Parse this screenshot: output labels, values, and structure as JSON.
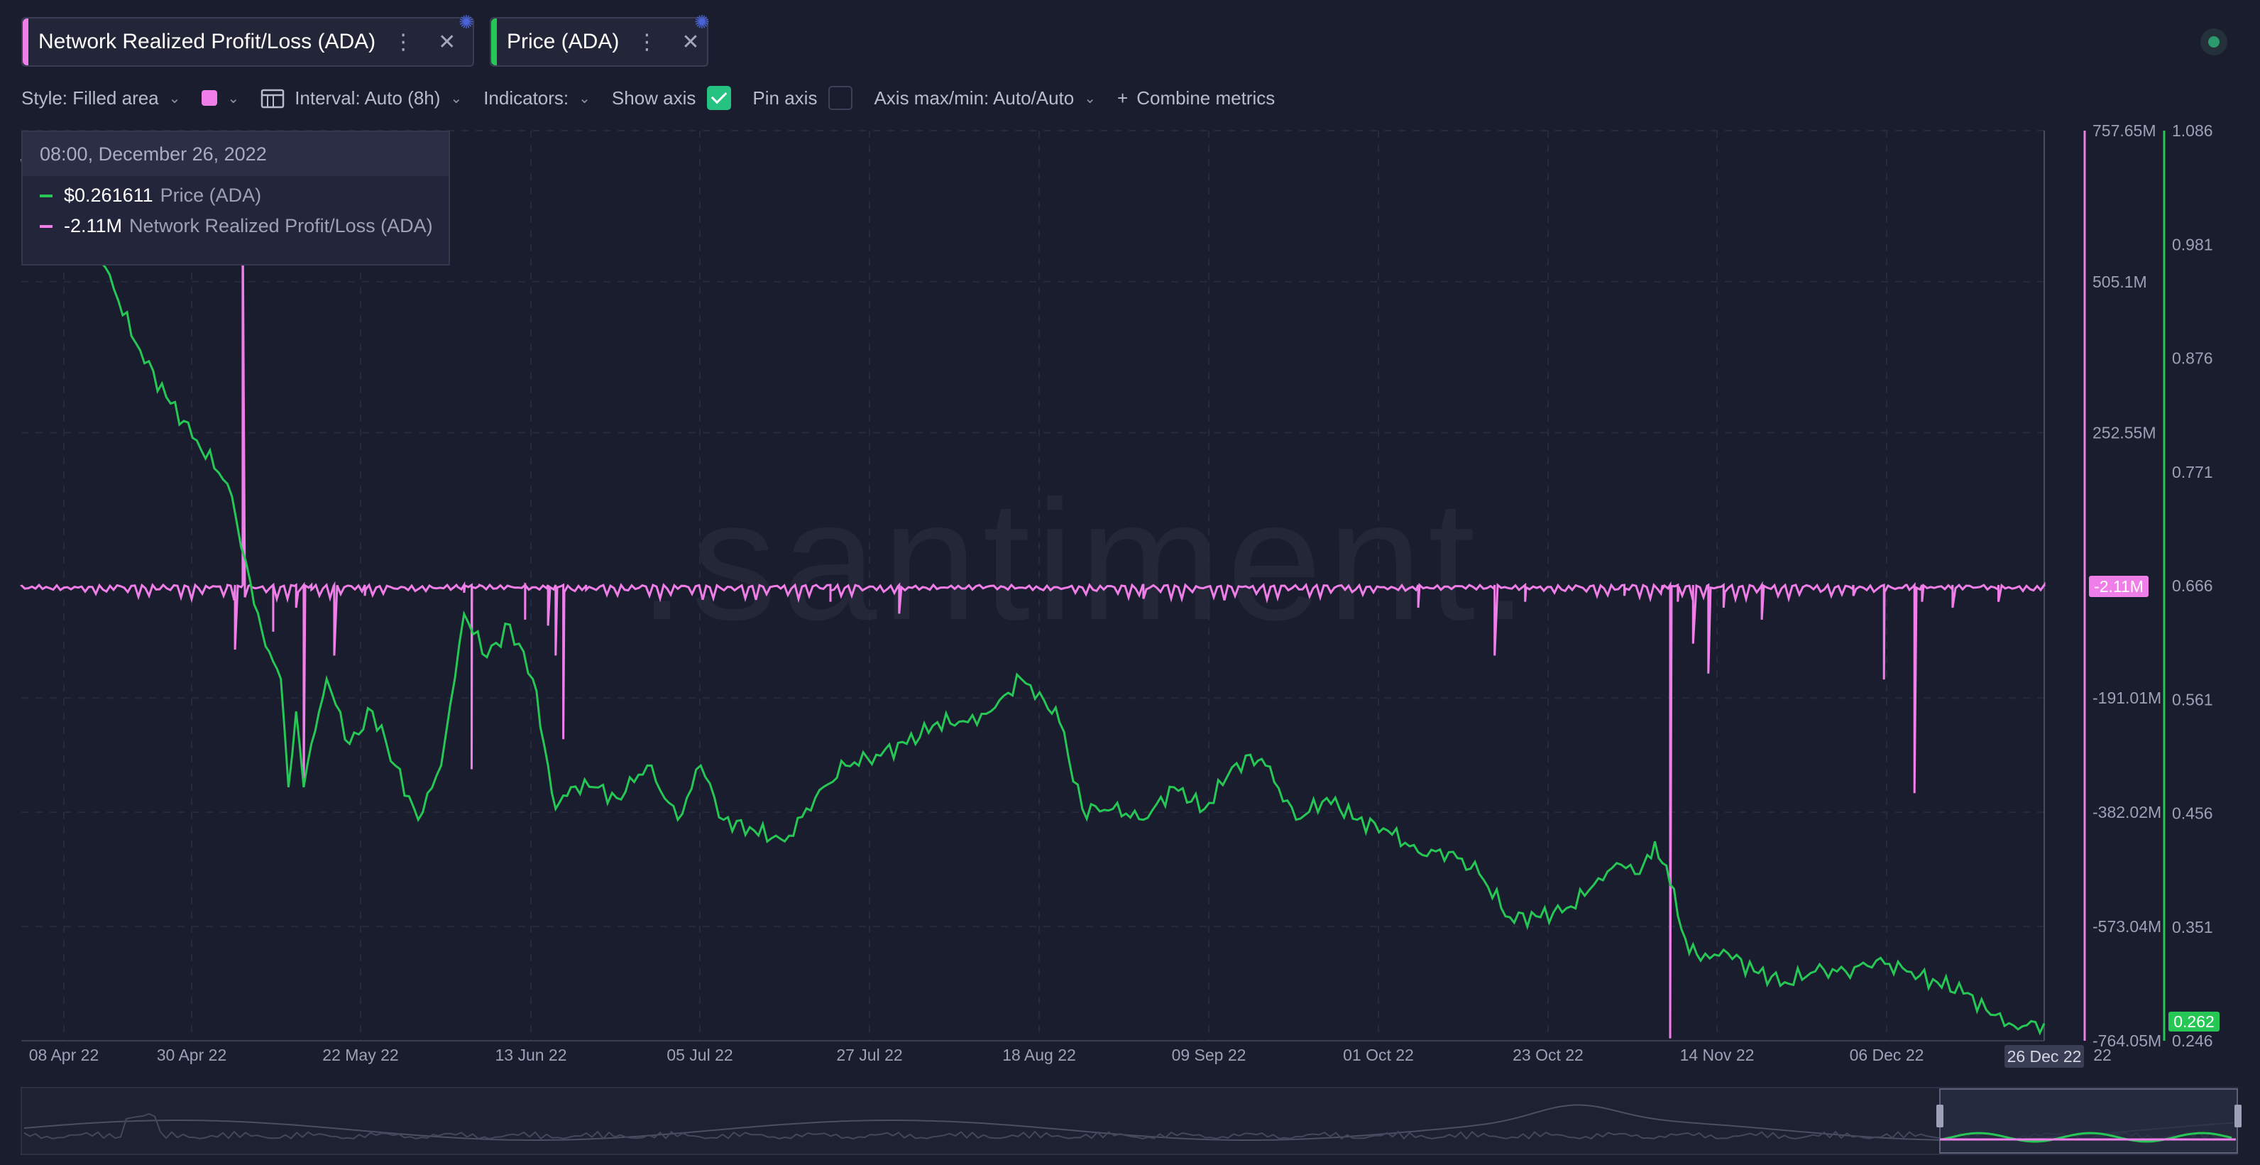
{
  "tabs": [
    {
      "label": "Network Realized Profit/Loss (ADA)",
      "color": "#f07ee8",
      "more_icon": "more-vertical-icon",
      "close_icon": "close-icon"
    },
    {
      "label": "Price (ADA)",
      "color": "#26c754",
      "more_icon": "more-vertical-icon",
      "close_icon": "close-icon"
    }
  ],
  "toolbar": {
    "style_label": "Style: Filled area",
    "interval_label": "Interval: Auto (8h)",
    "indicators_label": "Indicators:",
    "show_axis_label": "Show axis",
    "show_axis_checked": true,
    "pin_axis_label": "Pin axis",
    "pin_axis_checked": false,
    "axis_label": "Axis max/min: Auto/Auto",
    "combine_label": "Combine metrics"
  },
  "tooltip": {
    "date": "08:00, December 26, 2022",
    "rows": [
      {
        "value": "$0.261611",
        "name": "Price (ADA)",
        "color": "#26c754"
      },
      {
        "value": "-2.11M",
        "name": "Network Realized Profit/Loss (ADA)",
        "color": "#f07ee8"
      }
    ]
  },
  "watermark": ".santiment.",
  "chart_data": {
    "type": "line",
    "x_ticks": [
      "08 Apr 22",
      "30 Apr 22",
      "22 May 22",
      "13 Jun 22",
      "05 Jul 22",
      "27 Jul 22",
      "18 Aug 22",
      "09 Sep 22",
      "01 Oct 22",
      "23 Oct 22",
      "14 Nov 22",
      "06 Dec 22"
    ],
    "x_last_label": "22",
    "x_cursor_label": "26 Dec 22",
    "npl_axis": {
      "ticks": [
        "757.65M",
        "505.1M",
        "252.55M",
        "-191.01M",
        "-382.02M",
        "-573.04M",
        "-764.05M"
      ],
      "tick_values": [
        757.65,
        505.1,
        252.55,
        -191.01,
        -382.02,
        -573.04,
        -764.05
      ],
      "current_label": "-2.11M",
      "current_value": -2.11,
      "range": [
        -764.05,
        757.65
      ]
    },
    "price_axis": {
      "ticks": [
        "1.086",
        "0.981",
        "0.876",
        "0.771",
        "0.666",
        "0.561",
        "0.456",
        "0.351",
        "0.246"
      ],
      "tick_values": [
        1.086,
        0.981,
        0.876,
        0.771,
        0.666,
        0.561,
        0.456,
        0.351,
        0.246
      ],
      "current_label": "0.262",
      "current_value": 0.262,
      "range": [
        0.246,
        1.086
      ]
    },
    "series": [
      {
        "name": "Price (ADA)",
        "color": "#26c754",
        "axis": "price",
        "x": [
          "2022-04-05",
          "2022-04-08",
          "2022-04-12",
          "2022-04-16",
          "2022-04-20",
          "2022-04-24",
          "2022-04-28",
          "2022-05-02",
          "2022-05-05",
          "2022-05-07",
          "2022-05-09",
          "2022-05-10",
          "2022-05-11",
          "2022-05-12",
          "2022-05-13",
          "2022-05-15",
          "2022-05-18",
          "2022-05-21",
          "2022-05-24",
          "2022-05-27",
          "2022-05-30",
          "2022-06-02",
          "2022-06-05",
          "2022-06-08",
          "2022-06-11",
          "2022-06-13",
          "2022-06-14",
          "2022-06-16",
          "2022-06-19",
          "2022-06-22",
          "2022-06-26",
          "2022-06-30",
          "2022-07-03",
          "2022-07-06",
          "2022-07-10",
          "2022-07-14",
          "2022-07-18",
          "2022-07-22",
          "2022-07-26",
          "2022-07-30",
          "2022-08-03",
          "2022-08-07",
          "2022-08-10",
          "2022-08-14",
          "2022-08-17",
          "2022-08-19",
          "2022-08-22",
          "2022-08-26",
          "2022-08-30",
          "2022-09-03",
          "2022-09-07",
          "2022-09-10",
          "2022-09-13",
          "2022-09-15",
          "2022-09-19",
          "2022-09-23",
          "2022-09-27",
          "2022-10-01",
          "2022-10-05",
          "2022-10-09",
          "2022-10-13",
          "2022-10-17",
          "2022-10-21",
          "2022-10-25",
          "2022-10-28",
          "2022-10-31",
          "2022-11-03",
          "2022-11-05",
          "2022-11-07",
          "2022-11-09",
          "2022-11-11",
          "2022-11-14",
          "2022-11-18",
          "2022-11-22",
          "2022-11-26",
          "2022-11-30",
          "2022-12-04",
          "2022-12-08",
          "2022-12-12",
          "2022-12-16",
          "2022-12-19",
          "2022-12-22",
          "2022-12-26"
        ],
        "values": [
          1.06,
          1.02,
          0.99,
          0.96,
          0.89,
          0.84,
          0.8,
          0.76,
          0.67,
          0.61,
          0.58,
          0.48,
          0.55,
          0.48,
          0.52,
          0.58,
          0.52,
          0.55,
          0.5,
          0.45,
          0.5,
          0.64,
          0.6,
          0.63,
          0.58,
          0.5,
          0.46,
          0.48,
          0.48,
          0.47,
          0.5,
          0.45,
          0.5,
          0.45,
          0.44,
          0.43,
          0.47,
          0.5,
          0.51,
          0.52,
          0.54,
          0.54,
          0.55,
          0.58,
          0.56,
          0.54,
          0.46,
          0.46,
          0.45,
          0.48,
          0.46,
          0.49,
          0.51,
          0.5,
          0.45,
          0.47,
          0.45,
          0.44,
          0.42,
          0.42,
          0.4,
          0.36,
          0.36,
          0.37,
          0.39,
          0.41,
          0.4,
          0.43,
          0.39,
          0.34,
          0.32,
          0.33,
          0.31,
          0.3,
          0.31,
          0.31,
          0.32,
          0.31,
          0.3,
          0.29,
          0.27,
          0.26,
          0.262
        ]
      },
      {
        "name": "Network Realized Profit/Loss (ADA)",
        "color": "#f07ee8",
        "axis": "npl",
        "x": [
          "2022-04-05",
          "2022-05-02",
          "2022-05-03",
          "2022-05-04",
          "2022-05-05",
          "2022-05-08",
          "2022-05-11",
          "2022-05-12",
          "2022-05-13",
          "2022-05-16",
          "2022-05-20",
          "2022-06-01",
          "2022-06-02",
          "2022-06-03",
          "2022-06-04",
          "2022-06-10",
          "2022-06-13",
          "2022-06-14",
          "2022-06-15",
          "2022-06-18",
          "2022-07-20",
          "2022-07-29",
          "2022-08-30",
          "2022-10-05",
          "2022-10-15",
          "2022-10-19",
          "2022-11-01",
          "2022-11-06",
          "2022-11-07",
          "2022-11-08",
          "2022-11-10",
          "2022-11-12",
          "2022-11-14",
          "2022-11-19",
          "2022-12-01",
          "2022-12-05",
          "2022-12-08",
          "2022-12-09",
          "2022-12-10",
          "2022-12-14",
          "2022-12-20",
          "2022-12-26"
        ],
        "values": [
          -2,
          -2,
          -110,
          620,
          -3,
          -80,
          -40,
          -340,
          -10,
          -120,
          -20,
          -2,
          -15,
          -310,
          -2,
          -60,
          -70,
          -120,
          -260,
          -10,
          -30,
          -50,
          -25,
          -40,
          -120,
          -30,
          -20,
          -8,
          -760,
          -30,
          -100,
          -150,
          -40,
          -60,
          -20,
          -160,
          -2,
          -350,
          -30,
          -40,
          -30,
          -2.11
        ]
      }
    ],
    "legend": "top-left",
    "grid": true
  }
}
